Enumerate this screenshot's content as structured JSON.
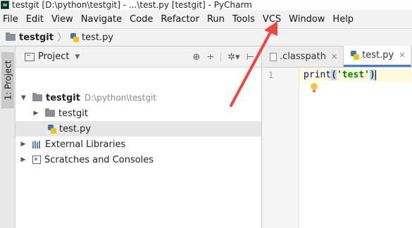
{
  "window": {
    "title": "testgit [D:\\python\\testgit] - ...\\test.py [testgit] - PyCharm"
  },
  "menubar": {
    "items": [
      "File",
      "Edit",
      "View",
      "Navigate",
      "Code",
      "Refactor",
      "Run",
      "Tools",
      "VCS",
      "Window",
      "Help"
    ]
  },
  "breadcrumb": {
    "project": "testgit",
    "file": "test.py"
  },
  "side_tab": {
    "label": "1: Project"
  },
  "project_panel": {
    "title": "Project",
    "tree": {
      "root": {
        "name": "testgit",
        "path": "D:\\python\\testgit"
      },
      "folder": "testgit",
      "file": "test.py",
      "external": "External Libraries",
      "scratches": "Scratches and Consoles"
    }
  },
  "editor": {
    "tabs": [
      {
        "label": ".classpath",
        "active": false
      },
      {
        "label": "test.py",
        "active": true
      }
    ],
    "line_number": "1",
    "code": {
      "fn": "print",
      "open": "(",
      "str": "'test'",
      "close": ")"
    }
  },
  "colors": {
    "accent_tab_underline": "#4083c9",
    "annotation_arrow": "#e8483d",
    "string": "#008000",
    "current_line": "#fffbdc"
  },
  "icons": {
    "app": "pycharm-icon",
    "project": "project-view-icon",
    "lightbulb": "intention-bulb-icon"
  }
}
